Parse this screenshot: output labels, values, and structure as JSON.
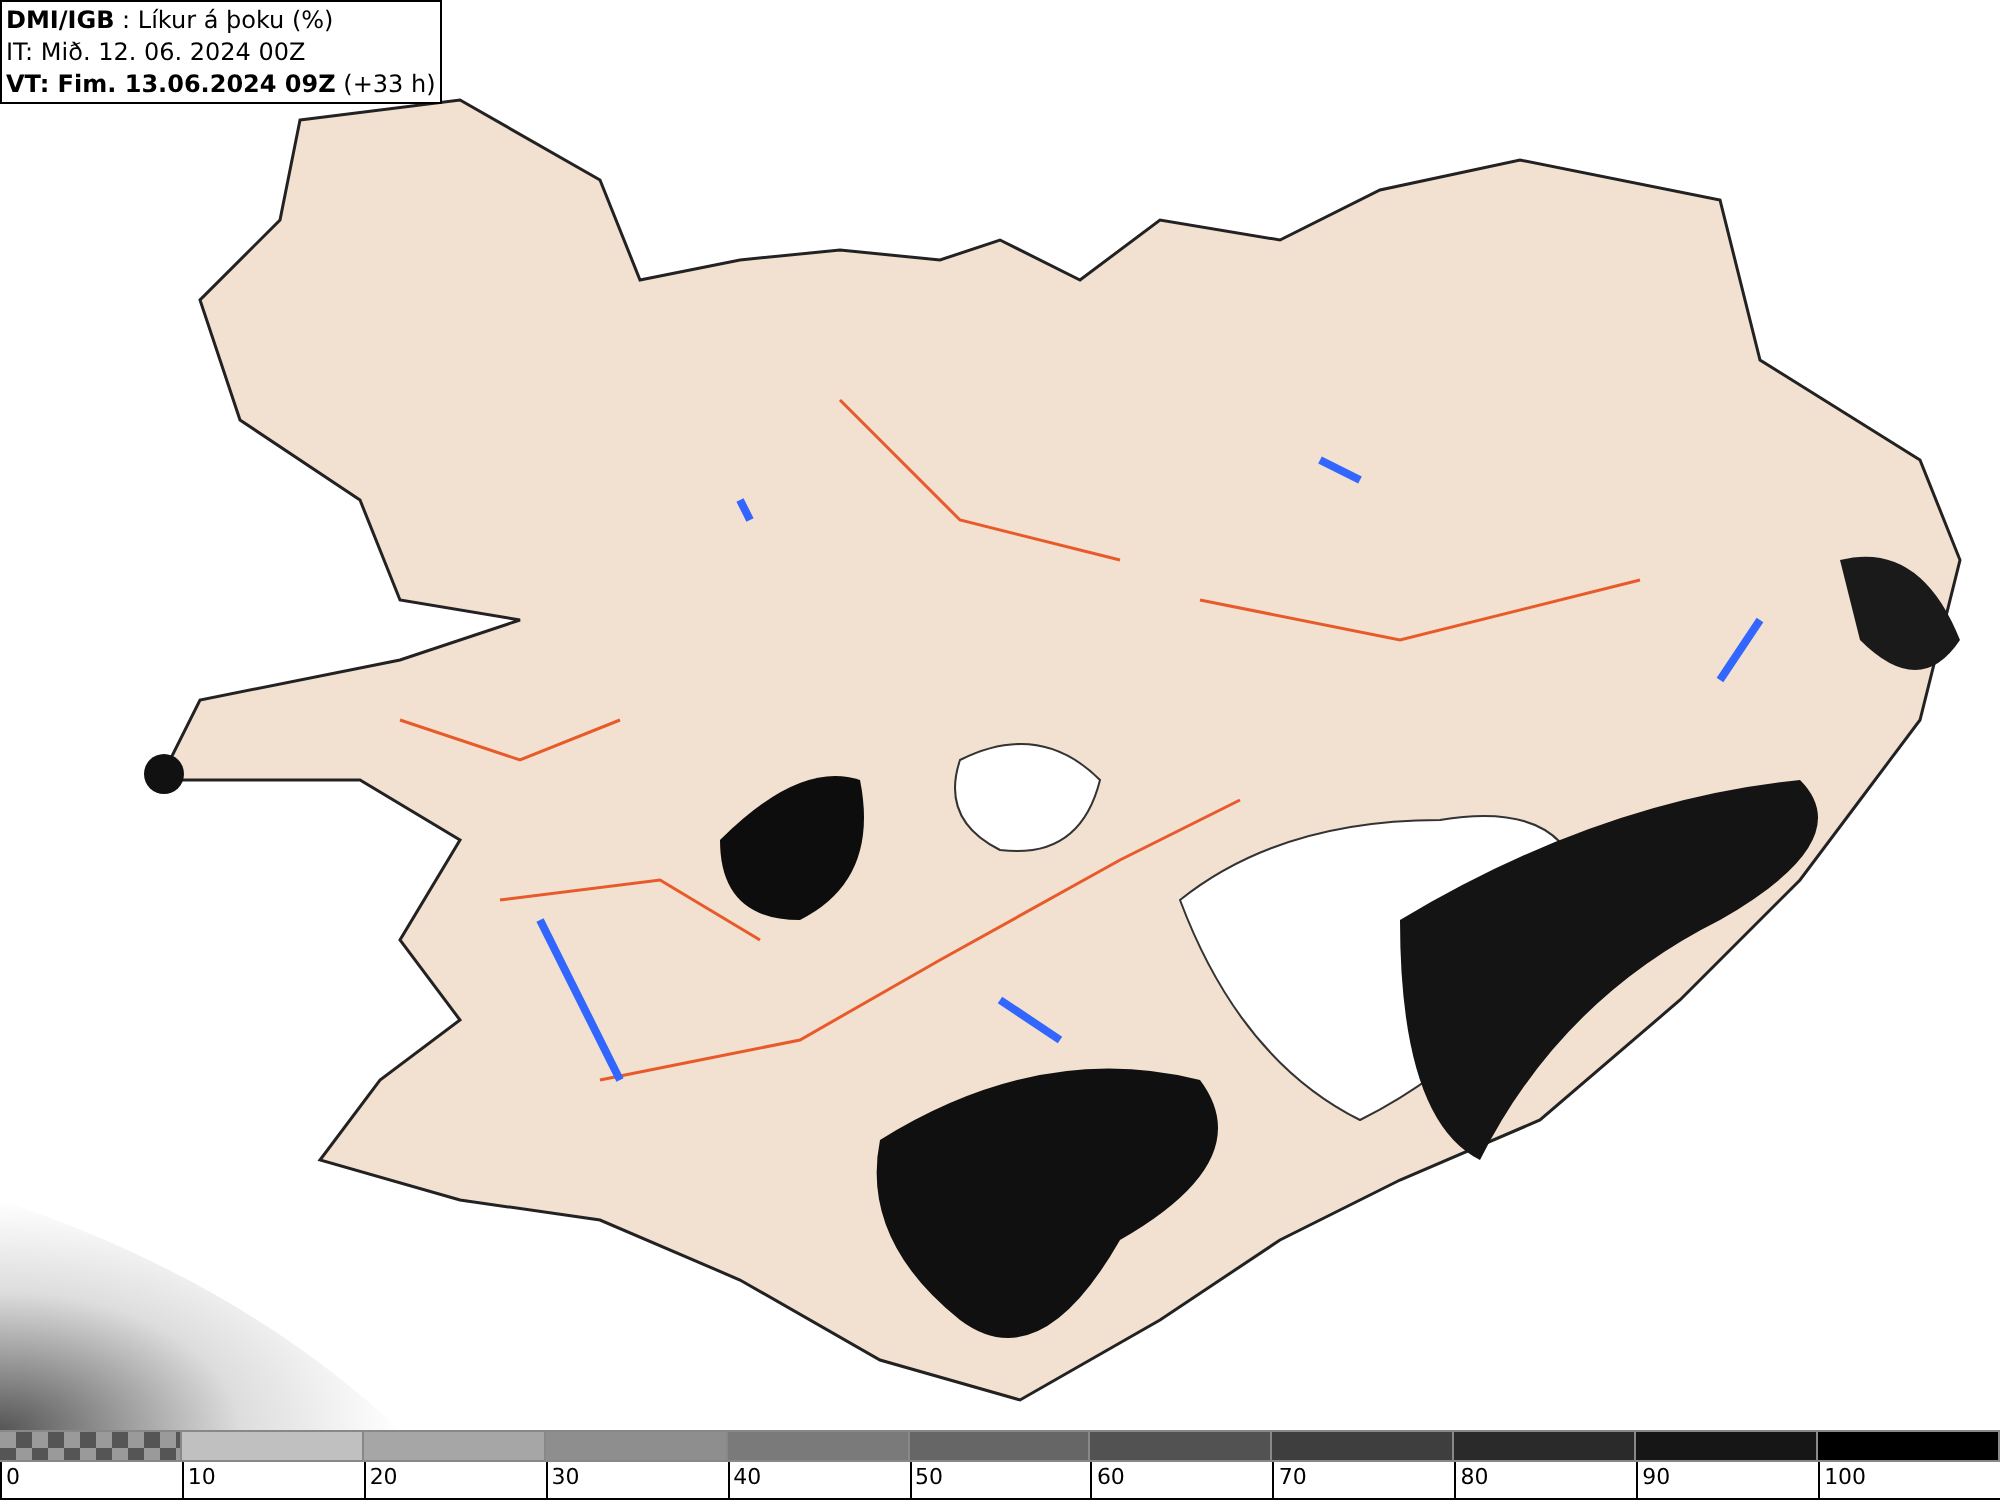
{
  "header": {
    "title": "**DMI/IGB** : Líkur á þoku (%)",
    "issue_time": "IT: Mið. 12. 06. 2024 00Z",
    "valid_time": "**VT: Fim. 13.06.2024 09Z** (+33 h)"
  },
  "legend": {
    "segments": [
      {
        "kind": "checker",
        "color": "#9a9a9a"
      },
      {
        "kind": "solid",
        "color": "#c0c0c0"
      },
      {
        "kind": "solid",
        "color": "#a6a6a6"
      },
      {
        "kind": "solid",
        "color": "#8e8e8e"
      },
      {
        "kind": "solid",
        "color": "#7a7a7a"
      },
      {
        "kind": "solid",
        "color": "#666666"
      },
      {
        "kind": "solid",
        "color": "#525252"
      },
      {
        "kind": "solid",
        "color": "#3e3e3e"
      },
      {
        "kind": "solid",
        "color": "#2a2a2a"
      },
      {
        "kind": "solid",
        "color": "#161616"
      },
      {
        "kind": "solid",
        "color": "#000000"
      }
    ],
    "labels": [
      "0",
      "10",
      "20",
      "30",
      "40",
      "50",
      "60",
      "70",
      "80",
      "90",
      "100"
    ]
  }
}
